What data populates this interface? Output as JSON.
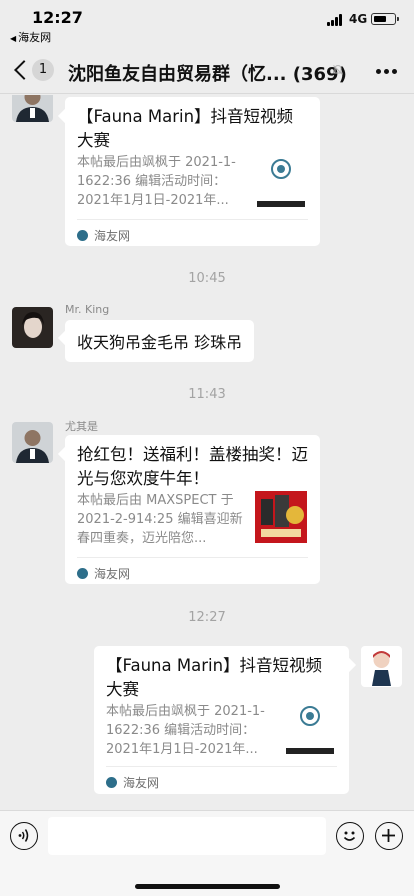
{
  "status_bar": {
    "time": "12:27",
    "back_app": "海友网",
    "network": "4G",
    "battery_level": 0.6
  },
  "nav": {
    "unread_count": "1",
    "title": "沈阳鱼友自由贸易群（忆...  (369)"
  },
  "messages": [
    {
      "type": "card",
      "card_title": "【Fauna Marin】抖音短视频大赛",
      "card_desc": "本帖最后由飒枫于 2021-1-1622:36 编辑活动时间：2021年1月1日-2021年...",
      "card_source": "海友网"
    },
    {
      "type": "time",
      "text": "10:45"
    },
    {
      "type": "text",
      "sender": "Mr. King",
      "text": "收天狗吊金毛吊 珍珠吊"
    },
    {
      "type": "time",
      "text": "11:43"
    },
    {
      "type": "card",
      "sender": "尤其是",
      "card_title": "抢红包！送福利！盖楼抽奖！迈光与您欢度牛年！",
      "card_desc": "本帖最后由 MAXSPECT 于 2021-2-914:25 编辑喜迎新春四重奏，迈光陪您...",
      "card_source": "海友网"
    },
    {
      "type": "time",
      "text": "12:27"
    },
    {
      "type": "card",
      "card_title": "【Fauna Marin】抖音短视频大赛",
      "card_desc": "本帖最后由飒枫于 2021-1-1622:36 编辑活动时间：2021年1月1日-2021年...",
      "card_source": "海友网"
    }
  ],
  "colors": {
    "chat_bg": "#ededed",
    "bubble": "#ffffff",
    "accent_red": "#c4161c"
  }
}
